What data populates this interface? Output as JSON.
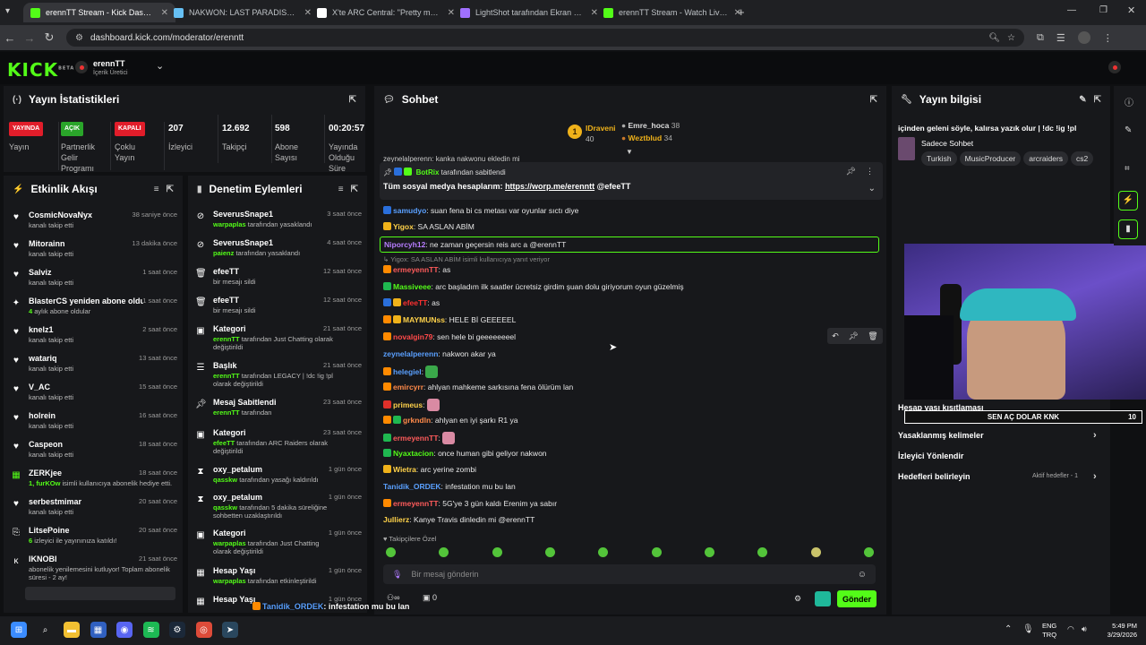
{
  "browser": {
    "tabs": [
      {
        "title": "erennTT Stream - Kick Dashboard",
        "active": true,
        "color": "#53fc18"
      },
      {
        "title": "NAKWON: LAST PARADISE Steam",
        "color": "#66c0f4"
      },
      {
        "title": "X'te ARC Central: \"Pretty much",
        "color": "#ffffff"
      },
      {
        "title": "LightShot tarafından Ekran Gör",
        "color": "#a070ff"
      },
      {
        "title": "erennTT Stream - Watch Live on",
        "color": "#53fc18"
      }
    ],
    "url": "dashboard.kick.com/moderator/erenntt"
  },
  "header": {
    "logo": "KICK",
    "logo_beta": "BETA",
    "channel": "erennTT",
    "role": "İçerik Üretici"
  },
  "stats": {
    "title": "Yayın İstatistikleri",
    "items": [
      {
        "badge": "YAYINDA",
        "badge_color": "#e11d2a",
        "label": "Yayın"
      },
      {
        "badge": "AÇIK",
        "badge_color": "#2aa52a",
        "label": "Partnerlik Gelir Programı"
      },
      {
        "badge": "KAPALI",
        "badge_color": "#e11d2a",
        "label": "Çoklu Yayın"
      },
      {
        "value": "207",
        "label": "İzleyici"
      },
      {
        "value": "12.692",
        "label": "Takipçi"
      },
      {
        "value": "598",
        "label": "Abone Sayısı"
      },
      {
        "value": "00:20:57",
        "label": "Yayında Olduğu Süre"
      }
    ]
  },
  "activity": {
    "title": "Etkinlik Akışı",
    "items": [
      {
        "icon": "heart",
        "name": "CosmicNovaNyx",
        "sub": "kanalı takip etti",
        "time": "38 saniye önce"
      },
      {
        "icon": "heart",
        "name": "Mitorainn",
        "sub": "kanalı takip etti",
        "time": "13 dakika önce"
      },
      {
        "icon": "heart",
        "name": "Salviz",
        "sub": "kanalı takip etti",
        "time": "1 saat önce"
      },
      {
        "icon": "sparkle",
        "name": "BlasterCS yeniden abone oldu!",
        "sub_pre": "4",
        "sub": "aylık abone oldular",
        "time": "1 saat önce"
      },
      {
        "icon": "heart",
        "name": "knelz1",
        "sub": "kanalı takip etti",
        "time": "2 saat önce"
      },
      {
        "icon": "heart",
        "name": "watariq",
        "sub": "kanalı takip etti",
        "time": "13 saat önce"
      },
      {
        "icon": "heart",
        "name": "V_AC",
        "sub": "kanalı takip etti",
        "time": "15 saat önce"
      },
      {
        "icon": "heart",
        "name": "holrein",
        "sub": "kanalı takip etti",
        "time": "16 saat önce"
      },
      {
        "icon": "heart",
        "name": "Caspeon",
        "sub": "kanalı takip etti",
        "time": "18 saat önce"
      },
      {
        "icon": "gift",
        "name": "ZERKjee",
        "sub_pre": "1, furKOw",
        "sub": "isimli kullanıcıya abonelik hediye etti.",
        "time": "18 saat önce"
      },
      {
        "icon": "heart",
        "name": "serbestmimar",
        "sub": "kanalı takip etti",
        "time": "20 saat önce"
      },
      {
        "icon": "host",
        "name": "LitsePoine",
        "sub_pre": "6",
        "sub": "izleyici ile yayınınıza katıldı!",
        "time": "20 saat önce"
      },
      {
        "icon": "kick",
        "name": "IKNOBI",
        "sub": "abonelik yenilemesini kutluyor! Toplam abonelik süresi - 2 ay!",
        "time": "21 saat önce"
      }
    ]
  },
  "moderation": {
    "title": "Denetim Eylemleri",
    "items": [
      {
        "icon": "ban",
        "name": "SeverusSnape1",
        "who": "warpaplas",
        "sub": "tarafından yasaklandı",
        "time": "3 saat önce"
      },
      {
        "icon": "ban",
        "name": "SeverusSnape1",
        "who": "paienz",
        "sub": "tarafından yasaklandı",
        "time": "4 saat önce"
      },
      {
        "icon": "trash",
        "name": "efeeTT",
        "sub": "bir mesajı sildi",
        "time": "12 saat önce"
      },
      {
        "icon": "trash",
        "name": "efeeTT",
        "sub": "bir mesajı sildi",
        "time": "12 saat önce"
      },
      {
        "icon": "category",
        "name": "Kategori",
        "who": "erennTT",
        "sub": "tarafından Just Chatting olarak değiştirildi",
        "time": "21 saat önce"
      },
      {
        "icon": "title",
        "name": "Başlık",
        "who": "erennTT",
        "sub": "tarafından LEGACY | !dc !ig !pl olarak değiştirildi",
        "time": "21 saat önce"
      },
      {
        "icon": "pin",
        "name": "Mesaj Sabitlendi",
        "who": "erennTT",
        "sub": "tarafından",
        "time": "23 saat önce"
      },
      {
        "icon": "category",
        "name": "Kategori",
        "who": "efeeTT",
        "sub": "tarafından ARC Raiders olarak değiştirildi",
        "time": "23 saat önce"
      },
      {
        "icon": "timer",
        "name": "oxy_petalum",
        "who": "qasskw",
        "sub": "tarafından yasağı kaldırıldı",
        "time": "1 gün önce"
      },
      {
        "icon": "timer",
        "name": "oxy_petalum",
        "who": "qasskw",
        "sub": "tarafından 5 dakika süreliğine sohbetten uzaklaştırıldı",
        "time": "1 gün önce"
      },
      {
        "icon": "category",
        "name": "Kategori",
        "who": "warpaplas",
        "sub": "tarafından Just Chatting olarak değiştirildi",
        "time": "1 gün önce"
      },
      {
        "icon": "calendar",
        "name": "Hesap Yaşı",
        "who": "warpaplas",
        "sub": "tarafından etkinleştirildi",
        "time": "1 gün önce"
      },
      {
        "icon": "calendar",
        "name": "Hesap Yaşı",
        "sub": "",
        "time": "1 gün önce"
      }
    ]
  },
  "chat": {
    "title": "Sohbet",
    "leaderboard": [
      {
        "rank": "1",
        "name": "IDraveni",
        "value": "40"
      },
      {
        "name": "Emre_hoca",
        "value": "38"
      },
      {
        "name": "Weztblud",
        "value": "34"
      }
    ],
    "cut_line": "zeynelalperenn: kanka nakwonu ekledin mi",
    "pinned": {
      "by": "BotRix",
      "by_label": "tarafından sabitlendi",
      "text": "Tüm sosyal medya hesaplarım: ",
      "link": "https://worp.me/erenntt",
      "tail": " @efeeTT"
    },
    "messages": [
      {
        "user": "samudyo",
        "color": "#5aa0ff",
        "text": ": suan fena bi cs metası var oyunlar sıctı diye"
      },
      {
        "user": "Yigox",
        "color": "#ffd24a",
        "text": ": SA ASLAN ABİM"
      },
      {
        "user": "Niporcyh12",
        "color": "#b77dff",
        "text": ": ne zaman geçersin reis arc a @erennTT",
        "highlight": true
      },
      {
        "reply": "Yigox: SA ASLAN ABİM isimli kullanıcıya yanıt veriyor"
      },
      {
        "user": "ermeyennTT",
        "color": "#ff5b5b",
        "text": ": as"
      },
      {
        "user": "Massiveee",
        "color": "#53fc18",
        "text": ": arc başladım ilk saatler ücretsiz girdim şuan dolu giriyorum oyun güzelmiş"
      },
      {
        "user": "efeeTT",
        "color": "#ff3030",
        "text": ": as"
      },
      {
        "user": "MAYMUNss",
        "color": "#ffd24a",
        "text": ": HELE Bİ GEEEEEL"
      },
      {
        "user": "novalgin79",
        "color": "#ff4a4a",
        "text": ": sen hele bi geeeeeeeel"
      },
      {
        "user": "zeynelalperenn",
        "color": "#5aa0ff",
        "text": ": nakwon akar ya"
      },
      {
        "user": "helegiel",
        "color": "#5aa0ff",
        "text": ":",
        "emote": true
      },
      {
        "user": "emircyrr",
        "color": "#ff8a4a",
        "text": ": ahlyan mahkeme sarkısına fena ölürüm lan"
      },
      {
        "user": "primeus",
        "color": "#ffd24a",
        "text": ":",
        "emote": true
      },
      {
        "user": "grkndln",
        "color": "#ff8a4a",
        "text": ": ahlyan en iyi şarkı R1 ya"
      },
      {
        "user": "ermeyennTT",
        "color": "#ff5b5b",
        "text": ":",
        "emote": true
      },
      {
        "user": "Nyaxtacion",
        "color": "#53fc18",
        "text": ": once human gibi geliyor nakwon"
      },
      {
        "user": "Wietra",
        "color": "#ffd24a",
        "text": ": arc yerine zombi"
      },
      {
        "user": "Tanidik_ORDEK",
        "color": "#5aa0ff",
        "text": ": infestation mu bu lan"
      },
      {
        "user": "ermeyennTT",
        "color": "#ff5b5b",
        "text": ": 5G'ye 3 gün kaldı Erenim ya sabır"
      },
      {
        "user": "Jullierz",
        "color": "#ffd24a",
        "text": ": Kanye Travis dinledin mi @erennTT"
      }
    ],
    "special_label": "Takipçilere Özel",
    "input_placeholder": "Bir mesaj gönderin",
    "count": "0",
    "send": "Gönder"
  },
  "streaminfo": {
    "title": "Yayın bilgisi",
    "stream_title": "içinden geleni söyle, kalırsa yazık olur | !dc !ig !pl",
    "category": "Sadece Sohbet",
    "tags": [
      "Turkish",
      "MusicProducer",
      "arcraiders",
      "cs2"
    ],
    "menu": [
      {
        "label": "Hesap yaşı kısıtlaması"
      },
      {
        "label": "Yasaklanmış kelimeler"
      },
      {
        "label": "İzleyici Yönlendir"
      },
      {
        "label": "Hedefleri belirleyin",
        "meta": "Aktif hedefler - 1"
      }
    ],
    "goal_label": "SEN AÇ DOLAR KNK",
    "goal_value": "10"
  },
  "overlay": [
    {
      "user": "Tanidik_ORDEK",
      "text": ": infestation mu bu lan"
    },
    {
      "user": "ermeyennTT",
      "text": ": 5G'ye 3 gün kaldı Erenim ya sabır"
    },
    {
      "user": "Jullierz",
      "text": ": Kanye Travis dinledin mi ",
      "mention": "@erennTT"
    }
  ],
  "taskbar": {
    "lang": "ENG",
    "region": "TRQ",
    "time": "5:49 PM",
    "date": "3/29/2026"
  }
}
